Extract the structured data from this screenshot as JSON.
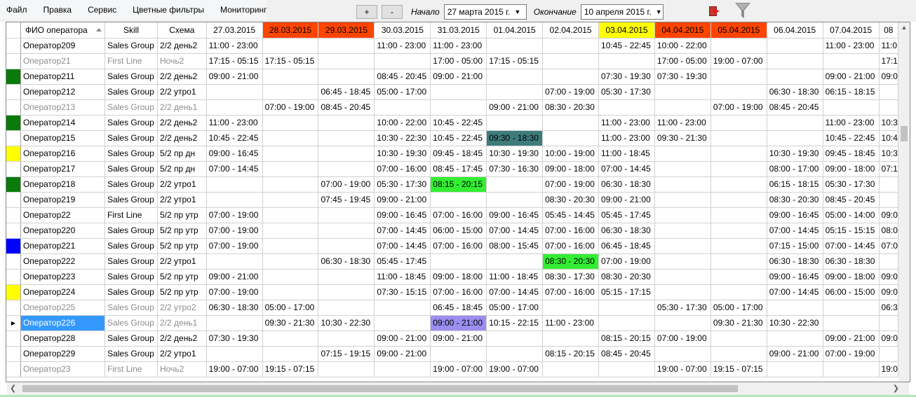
{
  "menu": [
    "Файл",
    "Правка",
    "Сервис",
    "Цветные фильтры",
    "Мониторинг"
  ],
  "toolbar": {
    "plus_label": "+",
    "minus_label": "-",
    "start_label": "Начало",
    "start_date": "27   марта   2015 г.",
    "end_label": "Окончание",
    "end_date": "10  апреля  2015 г."
  },
  "colors": {
    "header_red": "#ff4500",
    "header_yellow": "#ffff00",
    "mark_green": "#0a7a0a",
    "mark_yellow": "#ffff00",
    "mark_blue": "#0000ff",
    "cell_teal": "#3e7c7c",
    "cell_green": "#33ee33",
    "cell_purple": "#9b8ef0",
    "selection": "#3399ff"
  },
  "columns": [
    "ФИО оператора",
    "Skill",
    "Схема"
  ],
  "dates": [
    {
      "label": "27.03.2015",
      "color": ""
    },
    {
      "label": "28.03.2015",
      "color": "red"
    },
    {
      "label": "29.03.2015",
      "color": "red"
    },
    {
      "label": "30.03.2015",
      "color": ""
    },
    {
      "label": "31.03.2015",
      "color": ""
    },
    {
      "label": "01.04.2015",
      "color": ""
    },
    {
      "label": "02.04.2015",
      "color": ""
    },
    {
      "label": "03.04.2015",
      "color": "yellow"
    },
    {
      "label": "04.04.2015",
      "color": "red"
    },
    {
      "label": "05.04.2015",
      "color": "red"
    },
    {
      "label": "06.04.2015",
      "color": ""
    },
    {
      "label": "07.04.2015",
      "color": ""
    },
    {
      "label": "08",
      "color": ""
    }
  ],
  "rows": [
    {
      "name": "Оператор209",
      "skill": "Sales Group",
      "scheme": "2/2 день2",
      "inactive": false,
      "mark": "",
      "cells": [
        "11:00 - 23:00",
        "",
        "",
        "11:00 - 23:00",
        "11:00 - 23:00",
        "",
        "",
        "10:45 - 22:45",
        "10:00 - 22:00",
        "",
        "",
        "11:00 - 23:00",
        "11:0"
      ]
    },
    {
      "name": "Оператор21",
      "skill": "First Line",
      "scheme": "Ночь2",
      "inactive": true,
      "mark": "",
      "cells": [
        "17:15 - 05:15",
        "17:15 - 05:15",
        "",
        "",
        "17:00 - 05:00",
        "17:15 - 05:15",
        "",
        "",
        "17:00 - 05:00",
        "19:00 - 07:00",
        "",
        "",
        "17:1"
      ]
    },
    {
      "name": "Оператор211",
      "skill": "Sales Group",
      "scheme": "2/2 день2",
      "inactive": false,
      "mark": "green",
      "cells": [
        "09:00 - 21:00",
        "",
        "",
        "08:45 - 20:45",
        "09:00 - 21:00",
        "",
        "",
        "07:30 - 19:30",
        "07:30 - 19:30",
        "",
        "",
        "09:00 - 21:00",
        "09:0"
      ]
    },
    {
      "name": "Оператор212",
      "skill": "Sales Group",
      "scheme": "2/2 утро1",
      "inactive": false,
      "mark": "",
      "cells": [
        "",
        "",
        "06:45 - 18:45",
        "05:00 - 17:00",
        "",
        "",
        "07:00 - 19:00",
        "05:30 - 17:30",
        "",
        "",
        "06:30 - 18:30",
        "06:15 - 18:15",
        ""
      ]
    },
    {
      "name": "Оператор213",
      "skill": "Sales Group",
      "scheme": "2/2 день1",
      "inactive": true,
      "mark": "",
      "cells": [
        "",
        "07:00 - 19:00",
        "08:45 - 20:45",
        "",
        "",
        "09:00 - 21:00",
        "08:30 - 20:30",
        "",
        "",
        "07:00 - 19:00",
        "08:45 - 20:45",
        "",
        ""
      ]
    },
    {
      "name": "Оператор214",
      "skill": "Sales Group",
      "scheme": "2/2 день2",
      "inactive": false,
      "mark": "green",
      "cells": [
        "11:00 - 23:00",
        "",
        "",
        "10:00 - 22:00",
        "10:45 - 22:45",
        "",
        "",
        "11:00 - 23:00",
        "11:00 - 23:00",
        "",
        "",
        "11:00 - 23:00",
        "10:3"
      ]
    },
    {
      "name": "Оператор215",
      "skill": "Sales Group",
      "scheme": "2/2 день2",
      "inactive": false,
      "mark": "",
      "cells": [
        "10:45 - 22:45",
        "",
        "",
        "10:30 - 22:30",
        "10:45 - 22:45",
        "09:30 - 18:30",
        "",
        "11:00 - 23:00",
        "09:30 - 21:30",
        "",
        "",
        "10:45 - 22:45",
        "10:4"
      ],
      "hl": {
        "5": "teal"
      }
    },
    {
      "name": "Оператор216",
      "skill": "Sales Group",
      "scheme": "5/2 пр дн",
      "inactive": false,
      "mark": "yellow",
      "cells": [
        "09:00 - 16:45",
        "",
        "",
        "10:30 - 19:30",
        "09:45 - 18:45",
        "10:30 - 19:30",
        "10:00 - 19:00",
        "11:00 - 18:45",
        "",
        "",
        "10:30 - 19:30",
        "09:45 - 18:45",
        "10:3"
      ]
    },
    {
      "name": "Оператор217",
      "skill": "Sales Group",
      "scheme": "5/2 пр дн",
      "inactive": false,
      "mark": "",
      "cells": [
        "07:00 - 14:45",
        "",
        "",
        "07:00 - 16:00",
        "08:45 - 17:45",
        "07:30 - 16:30",
        "09:00 - 18:00",
        "07:00 - 14:45",
        "",
        "",
        "08:00 - 17:00",
        "09:00 - 18:00",
        "07:1"
      ]
    },
    {
      "name": "Оператор218",
      "skill": "Sales Group",
      "scheme": "2/2 утро1",
      "inactive": false,
      "mark": "green",
      "cells": [
        "",
        "",
        "07:00 - 19:00",
        "05:30 - 17:30",
        "08:15 - 20:15",
        "",
        "07:00 - 19:00",
        "06:30 - 18:30",
        "",
        "",
        "06:15 - 18:15",
        "05:30 - 17:30",
        ""
      ],
      "hl": {
        "4": "green"
      }
    },
    {
      "name": "Оператор219",
      "skill": "Sales Group",
      "scheme": "2/2 утро1",
      "inactive": false,
      "mark": "",
      "cells": [
        "",
        "",
        "07:45 - 19:45",
        "09:00 - 21:00",
        "",
        "",
        "08:30 - 20:30",
        "09:00 - 21:00",
        "",
        "",
        "08:30 - 20:30",
        "08:45 - 20:45",
        ""
      ]
    },
    {
      "name": "Оператор22",
      "skill": "First Line",
      "scheme": "5/2 пр утр",
      "inactive": false,
      "mark": "",
      "cells": [
        "07:00 - 19:00",
        "",
        "",
        "09:00 - 16:45",
        "07:00 - 16:00",
        "09:00 - 16:45",
        "05:45 - 14:45",
        "05:45 - 17:45",
        "",
        "",
        "09:00 - 16:45",
        "05:00 - 14:00",
        "09:0"
      ]
    },
    {
      "name": "Оператор220",
      "skill": "Sales Group",
      "scheme": "5/2 пр утр",
      "inactive": false,
      "mark": "",
      "cells": [
        "07:00 - 19:00",
        "",
        "",
        "07:00 - 14:45",
        "06:00 - 15:00",
        "07:00 - 14:45",
        "07:00 - 16:00",
        "06:30 - 18:30",
        "",
        "",
        "07:00 - 14:45",
        "05:15 - 15:15",
        "08:0"
      ]
    },
    {
      "name": "Оператор221",
      "skill": "Sales Group",
      "scheme": "5/2 пр утр",
      "inactive": false,
      "mark": "blue",
      "cells": [
        "07:00 - 19:00",
        "",
        "",
        "07:00 - 14:45",
        "07:00 - 16:00",
        "08:00 - 15:45",
        "07:00 - 16:00",
        "06:45 - 18:45",
        "",
        "",
        "07:15 - 15:00",
        "07:00 - 14:45",
        "07:0"
      ]
    },
    {
      "name": "Оператор222",
      "skill": "Sales Group",
      "scheme": "2/2 утро1",
      "inactive": false,
      "mark": "",
      "cells": [
        "",
        "",
        "06:30 - 18:30",
        "05:45 - 17:45",
        "",
        "",
        "08:30 - 20:30",
        "07:00 - 19:00",
        "",
        "",
        "06:30 - 18:30",
        "06:30 - 18:30",
        ""
      ],
      "hl": {
        "6": "green"
      }
    },
    {
      "name": "Оператор223",
      "skill": "Sales Group",
      "scheme": "5/2 пр утр",
      "inactive": false,
      "mark": "",
      "cells": [
        "09:00 - 21:00",
        "",
        "",
        "11:00 - 18:45",
        "09:00 - 18:00",
        "11:00 - 18:45",
        "08:30 - 17:30",
        "08:30 - 20:30",
        "",
        "",
        "09:00 - 16:45",
        "09:00 - 18:00",
        "09:0"
      ]
    },
    {
      "name": "Оператор224",
      "skill": "Sales Group",
      "scheme": "5/2 пр утр",
      "inactive": false,
      "mark": "yellow",
      "cells": [
        "07:00 - 19:00",
        "",
        "",
        "07:30 - 15:15",
        "07:00 - 16:00",
        "07:00 - 14:45",
        "07:00 - 16:00",
        "05:15 - 17:15",
        "",
        "",
        "07:00 - 14:45",
        "06:00 - 15:00",
        "09:0"
      ]
    },
    {
      "name": "Оператор225",
      "skill": "Sales Group",
      "scheme": "2/2 утро2",
      "inactive": true,
      "mark": "",
      "cells": [
        "06:30 - 18:30",
        "05:00 - 17:00",
        "",
        "",
        "06:45 - 18:45",
        "05:00 - 17:00",
        "",
        "",
        "05:30 - 17:30",
        "05:00 - 17:00",
        "",
        "",
        "06:3"
      ]
    },
    {
      "name": "Оператор226",
      "skill": "Sales Group",
      "scheme": "2/2 день1",
      "inactive": true,
      "mark": "",
      "current": true,
      "selected": true,
      "cells": [
        "",
        "09:30 - 21:30",
        "10:30 - 22:30",
        "",
        "09:00 - 21:00",
        "10:15 - 22:15",
        "11:00 - 23:00",
        "",
        "",
        "09:30 - 21:30",
        "10:30 - 22:30",
        "",
        ""
      ],
      "hl": {
        "4": "purple"
      }
    },
    {
      "name": "Оператор228",
      "skill": "Sales Group",
      "scheme": "2/2 день2",
      "inactive": false,
      "mark": "",
      "cells": [
        "07:30 - 19:30",
        "",
        "",
        "09:00 - 21:00",
        "09:00 - 21:00",
        "",
        "",
        "08:15 - 20:15",
        "07:00 - 19:00",
        "",
        "",
        "09:00 - 21:00",
        "09:0"
      ]
    },
    {
      "name": "Оператор229",
      "skill": "Sales Group",
      "scheme": "2/2 утро1",
      "inactive": false,
      "mark": "",
      "cells": [
        "",
        "",
        "07:15 - 19:15",
        "09:00 - 21:00",
        "",
        "",
        "08:15 - 20:15",
        "08:45 - 20:45",
        "",
        "",
        "09:00 - 21:00",
        "07:00 - 19:00",
        ""
      ]
    },
    {
      "name": "Оператор23",
      "skill": "First Line",
      "scheme": "Ночь2",
      "inactive": true,
      "mark": "",
      "cells": [
        "19:00 - 07:00",
        "19:15 - 07:15",
        "",
        "",
        "19:00 - 07:00",
        "19:00 - 07:00",
        "",
        "",
        "19:00 - 07:00",
        "19:15 - 07:15",
        "",
        "",
        "19:0"
      ]
    }
  ]
}
